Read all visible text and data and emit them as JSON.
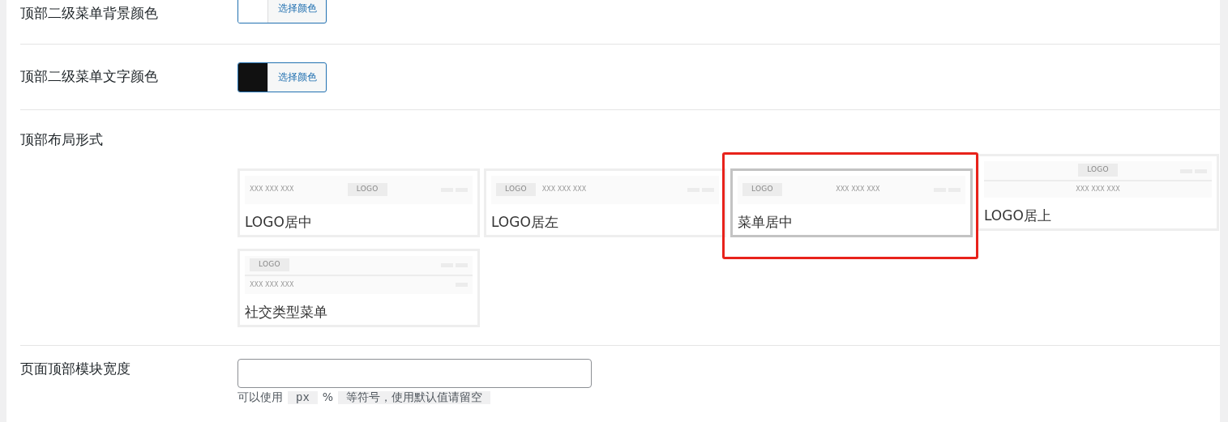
{
  "settings": [
    {
      "kind": "color",
      "label": "顶部二级菜单背景颜色",
      "button": "选择颜色",
      "color": "#ffffff"
    },
    {
      "kind": "color",
      "label": "顶部二级菜单文字颜色",
      "button": "选择颜色",
      "color": "#111111"
    },
    {
      "kind": "layout",
      "label": "顶部布局形式",
      "options": [
        {
          "kind": "logo-center",
          "caption": "LOGO居中",
          "logo": "LOGO",
          "menu": "XXX XXX XXX",
          "selected": false,
          "highlighted": false
        },
        {
          "kind": "logo-left",
          "caption": "LOGO居左",
          "logo": "LOGO",
          "menu": "XXX XXX XXX",
          "selected": false,
          "highlighted": false
        },
        {
          "kind": "menu-center",
          "caption": "菜单居中",
          "logo": "LOGO",
          "menu": "XXX XXX XXX",
          "selected": true,
          "highlighted": true
        },
        {
          "kind": "logo-top",
          "caption": "LOGO居上",
          "logo": "LOGO",
          "menu": "XXX XXX XXX",
          "selected": false,
          "highlighted": false
        },
        {
          "kind": "social",
          "caption": "社交类型菜单",
          "logo": "LOGO",
          "menu": "XXX XXX XXX",
          "selected": false,
          "highlighted": false
        }
      ]
    },
    {
      "kind": "text",
      "label": "页面顶部模块宽度",
      "help": [
        "可以使用",
        "px",
        "%",
        "等符号，使用默认值请留空"
      ]
    }
  ]
}
